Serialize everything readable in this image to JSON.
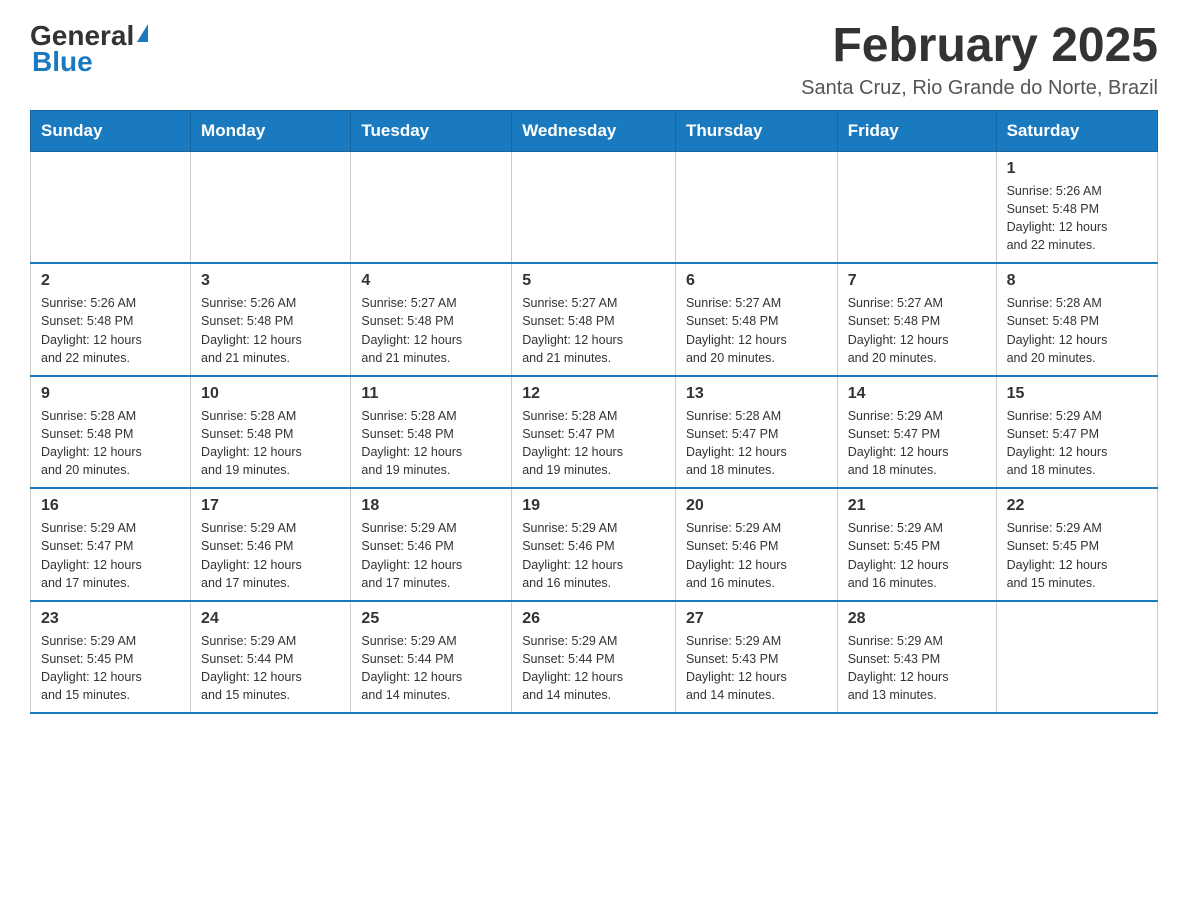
{
  "header": {
    "logo_general": "General",
    "logo_blue": "Blue",
    "month_title": "February 2025",
    "location": "Santa Cruz, Rio Grande do Norte, Brazil"
  },
  "calendar": {
    "days_of_week": [
      "Sunday",
      "Monday",
      "Tuesday",
      "Wednesday",
      "Thursday",
      "Friday",
      "Saturday"
    ],
    "weeks": [
      {
        "days": [
          {
            "number": "",
            "info": ""
          },
          {
            "number": "",
            "info": ""
          },
          {
            "number": "",
            "info": ""
          },
          {
            "number": "",
            "info": ""
          },
          {
            "number": "",
            "info": ""
          },
          {
            "number": "",
            "info": ""
          },
          {
            "number": "1",
            "info": "Sunrise: 5:26 AM\nSunset: 5:48 PM\nDaylight: 12 hours\nand 22 minutes."
          }
        ]
      },
      {
        "days": [
          {
            "number": "2",
            "info": "Sunrise: 5:26 AM\nSunset: 5:48 PM\nDaylight: 12 hours\nand 22 minutes."
          },
          {
            "number": "3",
            "info": "Sunrise: 5:26 AM\nSunset: 5:48 PM\nDaylight: 12 hours\nand 21 minutes."
          },
          {
            "number": "4",
            "info": "Sunrise: 5:27 AM\nSunset: 5:48 PM\nDaylight: 12 hours\nand 21 minutes."
          },
          {
            "number": "5",
            "info": "Sunrise: 5:27 AM\nSunset: 5:48 PM\nDaylight: 12 hours\nand 21 minutes."
          },
          {
            "number": "6",
            "info": "Sunrise: 5:27 AM\nSunset: 5:48 PM\nDaylight: 12 hours\nand 20 minutes."
          },
          {
            "number": "7",
            "info": "Sunrise: 5:27 AM\nSunset: 5:48 PM\nDaylight: 12 hours\nand 20 minutes."
          },
          {
            "number": "8",
            "info": "Sunrise: 5:28 AM\nSunset: 5:48 PM\nDaylight: 12 hours\nand 20 minutes."
          }
        ]
      },
      {
        "days": [
          {
            "number": "9",
            "info": "Sunrise: 5:28 AM\nSunset: 5:48 PM\nDaylight: 12 hours\nand 20 minutes."
          },
          {
            "number": "10",
            "info": "Sunrise: 5:28 AM\nSunset: 5:48 PM\nDaylight: 12 hours\nand 19 minutes."
          },
          {
            "number": "11",
            "info": "Sunrise: 5:28 AM\nSunset: 5:48 PM\nDaylight: 12 hours\nand 19 minutes."
          },
          {
            "number": "12",
            "info": "Sunrise: 5:28 AM\nSunset: 5:47 PM\nDaylight: 12 hours\nand 19 minutes."
          },
          {
            "number": "13",
            "info": "Sunrise: 5:28 AM\nSunset: 5:47 PM\nDaylight: 12 hours\nand 18 minutes."
          },
          {
            "number": "14",
            "info": "Sunrise: 5:29 AM\nSunset: 5:47 PM\nDaylight: 12 hours\nand 18 minutes."
          },
          {
            "number": "15",
            "info": "Sunrise: 5:29 AM\nSunset: 5:47 PM\nDaylight: 12 hours\nand 18 minutes."
          }
        ]
      },
      {
        "days": [
          {
            "number": "16",
            "info": "Sunrise: 5:29 AM\nSunset: 5:47 PM\nDaylight: 12 hours\nand 17 minutes."
          },
          {
            "number": "17",
            "info": "Sunrise: 5:29 AM\nSunset: 5:46 PM\nDaylight: 12 hours\nand 17 minutes."
          },
          {
            "number": "18",
            "info": "Sunrise: 5:29 AM\nSunset: 5:46 PM\nDaylight: 12 hours\nand 17 minutes."
          },
          {
            "number": "19",
            "info": "Sunrise: 5:29 AM\nSunset: 5:46 PM\nDaylight: 12 hours\nand 16 minutes."
          },
          {
            "number": "20",
            "info": "Sunrise: 5:29 AM\nSunset: 5:46 PM\nDaylight: 12 hours\nand 16 minutes."
          },
          {
            "number": "21",
            "info": "Sunrise: 5:29 AM\nSunset: 5:45 PM\nDaylight: 12 hours\nand 16 minutes."
          },
          {
            "number": "22",
            "info": "Sunrise: 5:29 AM\nSunset: 5:45 PM\nDaylight: 12 hours\nand 15 minutes."
          }
        ]
      },
      {
        "days": [
          {
            "number": "23",
            "info": "Sunrise: 5:29 AM\nSunset: 5:45 PM\nDaylight: 12 hours\nand 15 minutes."
          },
          {
            "number": "24",
            "info": "Sunrise: 5:29 AM\nSunset: 5:44 PM\nDaylight: 12 hours\nand 15 minutes."
          },
          {
            "number": "25",
            "info": "Sunrise: 5:29 AM\nSunset: 5:44 PM\nDaylight: 12 hours\nand 14 minutes."
          },
          {
            "number": "26",
            "info": "Sunrise: 5:29 AM\nSunset: 5:44 PM\nDaylight: 12 hours\nand 14 minutes."
          },
          {
            "number": "27",
            "info": "Sunrise: 5:29 AM\nSunset: 5:43 PM\nDaylight: 12 hours\nand 14 minutes."
          },
          {
            "number": "28",
            "info": "Sunrise: 5:29 AM\nSunset: 5:43 PM\nDaylight: 12 hours\nand 13 minutes."
          },
          {
            "number": "",
            "info": ""
          }
        ]
      }
    ]
  }
}
